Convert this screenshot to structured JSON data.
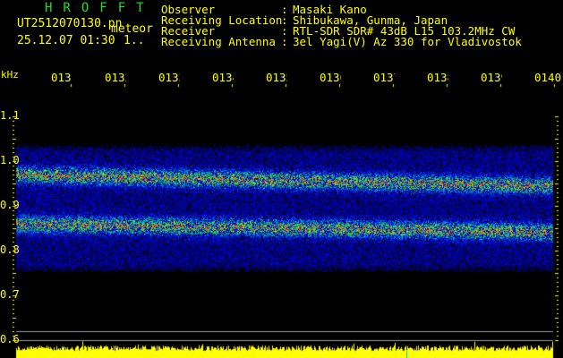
{
  "header": {
    "title": "HROFFT",
    "filename": "UT2512070130.pn",
    "mode": "meteor",
    "datetime": "25.12.07 01:30",
    "count": "1..",
    "fields": [
      {
        "label": "Observer",
        "value": "Masaki Kano"
      },
      {
        "label": "Receiving Location",
        "value": "Shibukawa, Gunma, Japan"
      },
      {
        "label": "Receiver",
        "value": "RTL-SDR SDR# 43dB L15 103.2MHz CW"
      },
      {
        "label": "Receiving Antenna",
        "value": "3el Yagi(V) Az 330 for Vladivostok"
      }
    ]
  },
  "chart_data": {
    "type": "heatmap",
    "title": "HROFFT meteor spectrogram",
    "ylabel": "kHz",
    "ylim": [
      0.6,
      1.1
    ],
    "yticks": [
      "1.1",
      "1.0",
      "0.9",
      "0.8",
      "0.7",
      "0.6"
    ],
    "xticks": [
      "0131",
      "0132",
      "0133",
      "0134",
      "0135",
      "0136",
      "0137",
      "0138",
      "0139",
      "0140"
    ],
    "bands_khz": [
      0.97,
      0.86
    ],
    "noise_range_khz": [
      0.76,
      1.05
    ]
  },
  "colors": {
    "text": "#ffff00",
    "title": "#22dd22",
    "background": "#000000",
    "histogram": "#ffff00"
  }
}
